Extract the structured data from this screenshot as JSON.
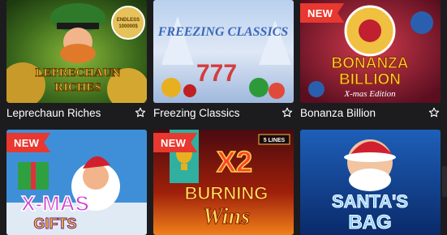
{
  "games": [
    {
      "title": "Leprechaun Riches",
      "art_title": "LEPRECHAUN RICHES",
      "art_badge": "ENDLESS 100000$",
      "new": false
    },
    {
      "title": "Freezing Classics",
      "art_title": "FREEZING CLASSICS",
      "new": false
    },
    {
      "title": "Bonanza Billion",
      "art_title": "BONANZA BILLION",
      "art_sub": "X-mas Edition",
      "new": true,
      "new_label": "NEW"
    },
    {
      "title": "X-mas Gifts",
      "art_title": "X-MAS GIFTS",
      "new": true,
      "new_label": "NEW"
    },
    {
      "title": "Burning Wins x2",
      "art_title": "BURNING Wins",
      "art_x2": "X2",
      "art_lines": "5 LINES",
      "new": true,
      "new_label": "NEW"
    },
    {
      "title": "Santa's Bag",
      "art_title": "SANTA'S BAG",
      "new": false
    }
  ],
  "colors": {
    "background": "#1c1c1f",
    "badge": "#e8382f",
    "text": "#ffffff"
  }
}
